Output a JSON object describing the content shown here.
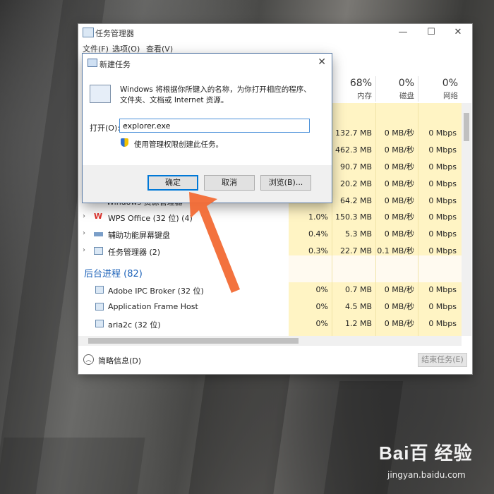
{
  "task_manager": {
    "title": "任务管理器",
    "menu": [
      "文件(F)",
      "选项(O)",
      "查看(V)"
    ],
    "headers": [
      {
        "pct": "68%",
        "label": "内存"
      },
      {
        "pct": "0%",
        "label": "磁盘"
      },
      {
        "pct": "0%",
        "label": "网络"
      }
    ],
    "apps_rows": [
      {
        "name": "",
        "mem": "132.7 MB",
        "disk": "0 MB/秒",
        "net": "0 Mbps",
        "cpu": ""
      },
      {
        "name": "",
        "mem": "462.3 MB",
        "disk": "0 MB/秒",
        "net": "0 Mbps",
        "cpu": ""
      },
      {
        "name": "",
        "mem": "90.7 MB",
        "disk": "0 MB/秒",
        "net": "0 Mbps",
        "cpu": ""
      },
      {
        "name": "",
        "mem": "20.2 MB",
        "disk": "0 MB/秒",
        "net": "0 Mbps",
        "cpu": ""
      },
      {
        "name": "Windows 资源管理器",
        "mem": "64.2 MB",
        "disk": "0 MB/秒",
        "net": "0 Mbps",
        "cpu": "0%"
      },
      {
        "name": "WPS Office (32 位) (4)",
        "mem": "150.3 MB",
        "disk": "0 MB/秒",
        "net": "0 Mbps",
        "cpu": "1.0%"
      },
      {
        "name": "辅助功能屏幕键盘",
        "mem": "5.3 MB",
        "disk": "0 MB/秒",
        "net": "0 Mbps",
        "cpu": "0.4%"
      },
      {
        "name": "任务管理器 (2)",
        "mem": "22.7 MB",
        "disk": "0.1 MB/秒",
        "net": "0 Mbps",
        "cpu": "0.3%"
      }
    ],
    "background_title": "后台进程 (82)",
    "bg_rows": [
      {
        "name": "Adobe IPC Broker (32 位)",
        "cpu": "0%",
        "mem": "0.7 MB",
        "disk": "0 MB/秒",
        "net": "0 Mbps"
      },
      {
        "name": "Application Frame Host",
        "cpu": "0%",
        "mem": "4.5 MB",
        "disk": "0 MB/秒",
        "net": "0 Mbps"
      },
      {
        "name": "aria2c (32 位)",
        "cpu": "0%",
        "mem": "1.2 MB",
        "disk": "0 MB/秒",
        "net": "0 Mbps"
      }
    ],
    "fewer_details": "简略信息(D)",
    "end_task": "结束任务(E)"
  },
  "run_dialog": {
    "title": "新建任务",
    "description": "Windows 将根据你所键入的名称，为你打开相应的程序、文件夹、文档或 Internet 资源。",
    "open_label": "打开(O):",
    "input_value": "explorer.exe",
    "admin_text": "使用管理权限创建此任务。",
    "ok_label": "确定",
    "cancel_label": "取消",
    "browse_label": "浏览(B)..."
  },
  "watermark": {
    "brand": "Bai百 经验",
    "url": "jingyan.baidu.com"
  },
  "colors": {
    "accent": "#0078d7",
    "highlight": "#fff4c4",
    "arrow": "#f26a34",
    "section": "#1c62b9"
  }
}
